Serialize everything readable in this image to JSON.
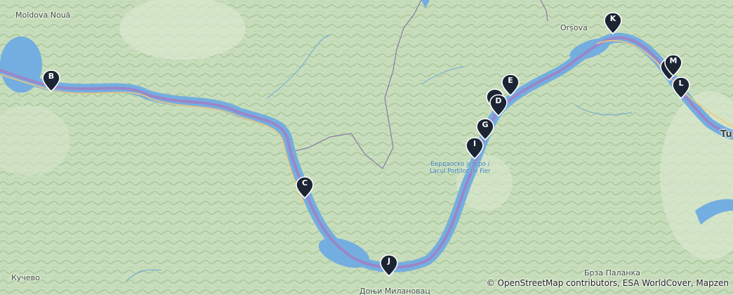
{
  "place_labels": {
    "moldova_noua": "Moldova Nouă",
    "orsova": "Orșova",
    "kucevo": "Кучево",
    "brza_palanka": "Брза Паланка",
    "donji_milanovac": "Доњи Милановац",
    "tu": "Tu"
  },
  "water_label": {
    "line1": "Бердапско језеро /",
    "line2": "Lacul Porților de Fier"
  },
  "markers": [
    "B",
    "C",
    "D",
    "E",
    "G",
    "I",
    "J",
    "K",
    "L",
    "M"
  ],
  "attribution": "© OpenStreetMap contributors, ESA WorldCover, Mapzen",
  "colors": {
    "water": "#74aee0",
    "route": "#9a86c8",
    "marker": "#1b2533",
    "border": "#8a7aa8"
  }
}
